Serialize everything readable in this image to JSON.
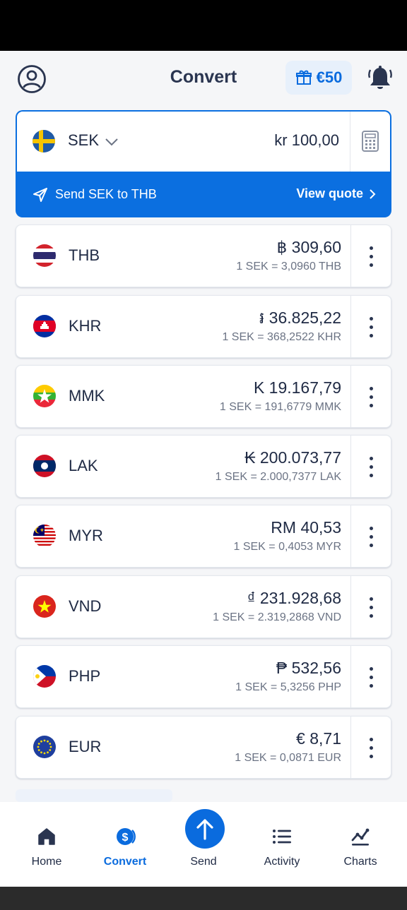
{
  "header": {
    "title": "Convert",
    "reward_label": "€50"
  },
  "source": {
    "currency_code": "SEK",
    "amount": "kr 100,00",
    "send_label": "Send SEK to THB",
    "view_quote_label": "View quote"
  },
  "rates": [
    {
      "code": "THB",
      "amount": "฿ 309,60",
      "rate": "1 SEK = 3,0960 THB"
    },
    {
      "code": "KHR",
      "amount": "៛ 36.825,22",
      "rate": "1 SEK = 368,2522 KHR"
    },
    {
      "code": "MMK",
      "amount": "K 19.167,79",
      "rate": "1 SEK = 191,6779 MMK"
    },
    {
      "code": "LAK",
      "amount": "₭ 200.073,77",
      "rate": "1 SEK = 2.000,7377 LAK"
    },
    {
      "code": "MYR",
      "amount": "RM 40,53",
      "rate": "1 SEK = 0,4053 MYR"
    },
    {
      "code": "VND",
      "amount": "₫ 231.928,68",
      "rate": "1 SEK = 2.319,2868 VND"
    },
    {
      "code": "PHP",
      "amount": "₱ 532,56",
      "rate": "1 SEK = 5,3256 PHP"
    },
    {
      "code": "EUR",
      "amount": "€ 8,71",
      "rate": "1 SEK = 0,0871 EUR"
    }
  ],
  "nav": {
    "home": "Home",
    "convert": "Convert",
    "send": "Send",
    "activity": "Activity",
    "charts": "Charts"
  },
  "colors": {
    "accent": "#0a6bde",
    "text": "#1f2a44",
    "muted": "#6b7384"
  }
}
